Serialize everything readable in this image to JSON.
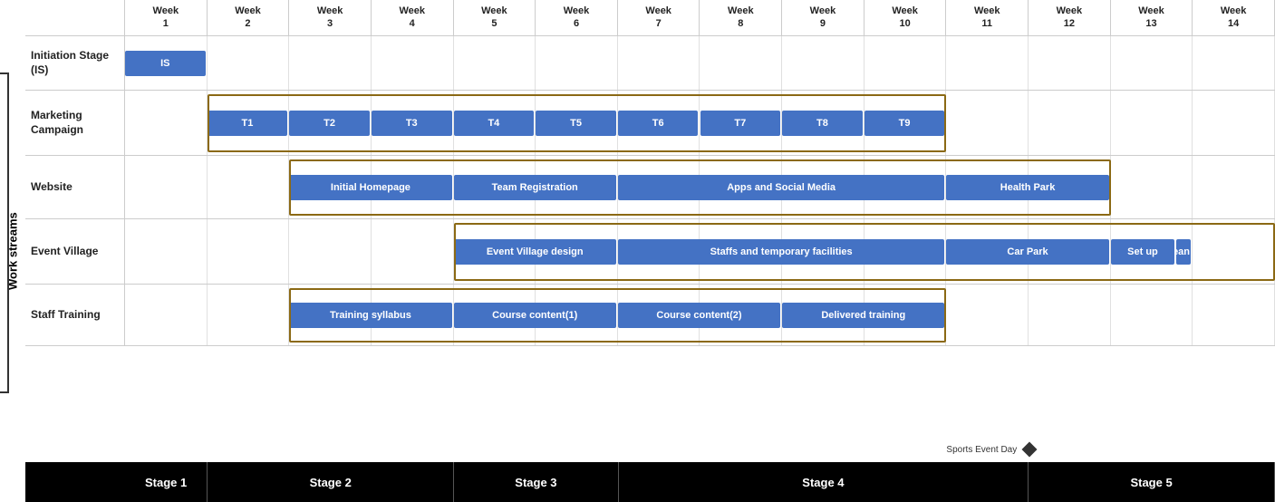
{
  "yAxisLabel": "Work streams",
  "weeks": [
    {
      "label": "Week\n1"
    },
    {
      "label": "Week\n2"
    },
    {
      "label": "Week\n3"
    },
    {
      "label": "Week\n4"
    },
    {
      "label": "Week\n5"
    },
    {
      "label": "Week\n6"
    },
    {
      "label": "Week\n7"
    },
    {
      "label": "Week\n8"
    },
    {
      "label": "Week\n9"
    },
    {
      "label": "Week\n10"
    },
    {
      "label": "Week\n11"
    },
    {
      "label": "Week\n12"
    },
    {
      "label": "Week\n13"
    },
    {
      "label": "Week\n14"
    }
  ],
  "rows": [
    {
      "id": "initiation",
      "label": "Initiation Stage (IS)",
      "bars": [
        {
          "id": "IS",
          "label": "IS",
          "startWeek": 1,
          "endWeek": 2,
          "spanWeeks": 1
        }
      ]
    },
    {
      "id": "marketing",
      "label": "Marketing Campaign",
      "bars": [
        {
          "id": "T1",
          "label": "T1",
          "startWeek": 2,
          "spanWeeks": 1
        },
        {
          "id": "T2",
          "label": "T2",
          "startWeek": 3,
          "spanWeeks": 1
        },
        {
          "id": "T3",
          "label": "T3",
          "startWeek": 4,
          "spanWeeks": 1
        },
        {
          "id": "T4",
          "label": "T4",
          "startWeek": 5,
          "spanWeeks": 1
        },
        {
          "id": "T5",
          "label": "T5",
          "startWeek": 6,
          "spanWeeks": 1
        },
        {
          "id": "T6",
          "label": "T6",
          "startWeek": 7,
          "spanWeeks": 1
        },
        {
          "id": "T7",
          "label": "T7",
          "startWeek": 8,
          "spanWeeks": 1
        },
        {
          "id": "T8",
          "label": "T8",
          "startWeek": 9,
          "spanWeeks": 1
        },
        {
          "id": "T9",
          "label": "T9",
          "startWeek": 10,
          "spanWeeks": 1
        }
      ]
    },
    {
      "id": "website",
      "label": "Website",
      "bars": [
        {
          "id": "initial-homepage",
          "label": "Initial Homepage",
          "startWeek": 3,
          "spanWeeks": 2
        },
        {
          "id": "team-registration",
          "label": "Team Registration",
          "startWeek": 5,
          "spanWeeks": 2
        },
        {
          "id": "apps-social-media",
          "label": "Apps and Social Media",
          "startWeek": 7,
          "spanWeeks": 4
        },
        {
          "id": "health-park",
          "label": "Health Park",
          "startWeek": 11,
          "spanWeeks": 2
        }
      ]
    },
    {
      "id": "village",
      "label": "Event Village",
      "bars": [
        {
          "id": "event-village-design",
          "label": "Event Village design",
          "startWeek": 5,
          "spanWeeks": 2
        },
        {
          "id": "staffs-facilities",
          "label": "Staffs and temporary facilities",
          "startWeek": 7,
          "spanWeeks": 4
        },
        {
          "id": "car-park",
          "label": "Car Park",
          "startWeek": 11,
          "spanWeeks": 2
        },
        {
          "id": "set-up",
          "label": "Set up",
          "startWeek": 13,
          "spanWeeks": 0.8
        },
        {
          "id": "clean-up",
          "label": "Clean up",
          "startWeek": 13.8,
          "spanWeeks": 0.2
        }
      ]
    },
    {
      "id": "training",
      "label": "Staff Training",
      "bars": [
        {
          "id": "training-syllabus",
          "label": "Training syllabus",
          "startWeek": 3,
          "spanWeeks": 2
        },
        {
          "id": "course-content-1",
          "label": "Course content(1)",
          "startWeek": 5,
          "spanWeeks": 2
        },
        {
          "id": "course-content-2",
          "label": "Course content(2)",
          "startWeek": 7,
          "spanWeeks": 2
        },
        {
          "id": "delivered-training",
          "label": "Delivered training",
          "startWeek": 9,
          "spanWeeks": 2
        }
      ]
    }
  ],
  "sportsEvent": {
    "label": "Sports Event Day",
    "startWeek": 11,
    "icon": "diamond"
  },
  "stages": [
    {
      "id": "stage1",
      "label": "Stage 1",
      "startWeek": 0,
      "spanWeeks": 1
    },
    {
      "id": "stage2",
      "label": "Stage 2",
      "startWeek": 1,
      "spanWeeks": 3
    },
    {
      "id": "stage3",
      "label": "Stage 3",
      "startWeek": 4,
      "spanWeeks": 2
    },
    {
      "id": "stage4",
      "label": "Stage 4",
      "startWeek": 6,
      "spanWeeks": 5
    },
    {
      "id": "stage5",
      "label": "Stage 5",
      "startWeek": 11,
      "spanWeeks": 3
    }
  ],
  "groupBoxes": [
    {
      "id": "marketing-group",
      "label": "Marketing Campaign group"
    },
    {
      "id": "website-group",
      "label": "Website group"
    },
    {
      "id": "village-group",
      "label": "Event Village group"
    },
    {
      "id": "training-group",
      "label": "Staff Training group"
    }
  ]
}
